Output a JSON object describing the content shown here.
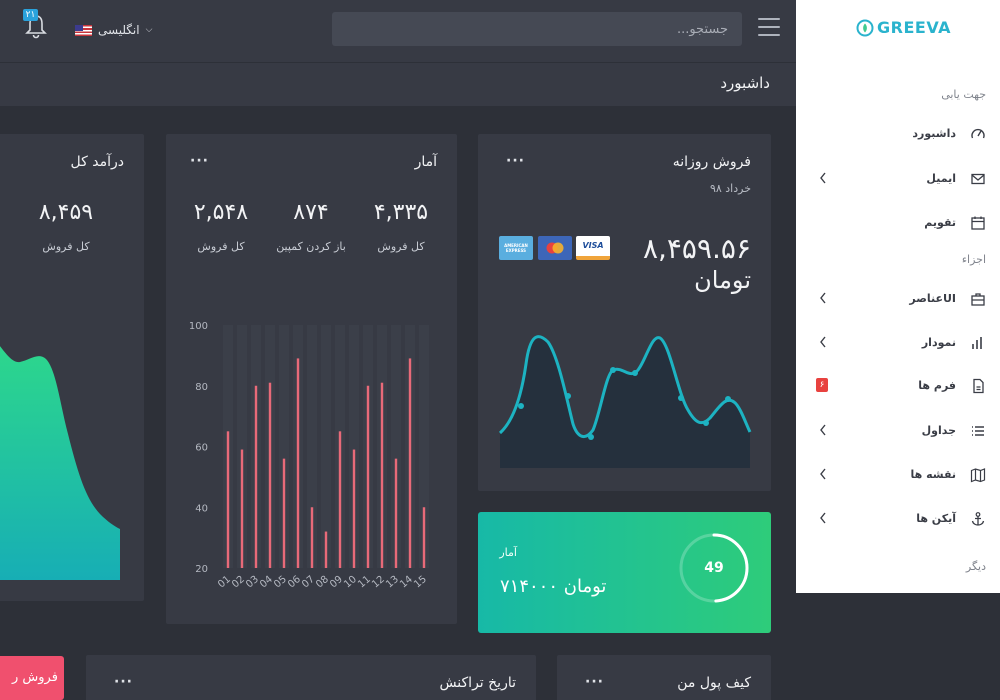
{
  "topbar": {
    "search_placeholder": "جستجو...",
    "language": "انگلیسی",
    "notification_count": "۲۱"
  },
  "page": {
    "title": "داشبورد"
  },
  "cards": {
    "revenue": {
      "title": "درآمد کل",
      "value": "۸,۴۵۹",
      "label": "کل فروش"
    },
    "stats": {
      "title": "آمار",
      "items": [
        {
          "value": "۴,۳۳۵",
          "label": "کل فروش"
        },
        {
          "value": "۸۷۴",
          "label": "باز کردن کمپین"
        },
        {
          "value": "۲,۵۴۸",
          "label": "کل فروش"
        }
      ]
    },
    "daily": {
      "title": "فروش روزانه",
      "subtitle": "خرداد ۹۸",
      "amount": "۸,۴۵۹.۵۶",
      "currency": "تومان",
      "cards": [
        "AMERICAN EXPRESS",
        "Mastercard",
        "VISA"
      ]
    },
    "stat_green": {
      "label": "آمار",
      "value": "۷۱۴۰۰۰ تومان",
      "ring_value": "49",
      "ring_progress": 0.49
    },
    "wallet": {
      "title": "کیف پول من"
    },
    "transactions": {
      "title": "تاریخ تراکنش"
    },
    "sales_tab": {
      "label": "فروش ر"
    }
  },
  "chart_data": {
    "type": "bar",
    "categories": [
      "01",
      "02",
      "03",
      "04",
      "05",
      "06",
      "07",
      "08",
      "09",
      "10",
      "11",
      "12",
      "13",
      "14",
      "15"
    ],
    "values": [
      65,
      59,
      80,
      81,
      56,
      89,
      40,
      32,
      65,
      59,
      80,
      81,
      56,
      89,
      40
    ],
    "ylim": [
      20,
      100
    ],
    "yticks": [
      20,
      40,
      60,
      80,
      100
    ],
    "color": "#e86a79"
  },
  "sidebar": {
    "brand": "GREEVA",
    "sections": {
      "navigation": "جهت یابی",
      "components": "اجزاء",
      "other": "دیگر"
    },
    "items": [
      {
        "label": "داشبورد",
        "icon": "speedometer-icon"
      },
      {
        "label": "ایمیل",
        "icon": "envelope-icon"
      },
      {
        "label": "تقویم",
        "icon": "calendar-icon"
      },
      {
        "label": "عناصرUI",
        "icon": "briefcase-icon"
      },
      {
        "label": "نمودار",
        "icon": "bar-chart-icon"
      },
      {
        "label": "فرم ها",
        "icon": "file-icon",
        "badge": "۶"
      },
      {
        "label": "جداول",
        "icon": "list-icon"
      },
      {
        "label": "نقشه ها",
        "icon": "map-icon"
      },
      {
        "label": "آیکن ها",
        "icon": "anchor-icon"
      }
    ]
  }
}
